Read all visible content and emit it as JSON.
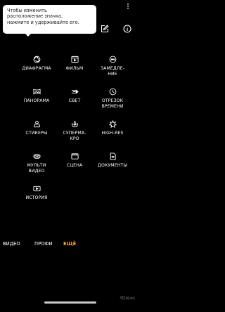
{
  "tooltip": {
    "lines": [
      "Чтобы изменить",
      "расположение значка,",
      "нажмите и удерживайте его."
    ]
  },
  "top_icons": [
    "edit-icon",
    "info-icon"
  ],
  "modes_grid": [
    [
      {
        "icon": "aperture-icon",
        "label": "ДИАФРАГМА"
      },
      {
        "icon": "film-icon",
        "label": "ФИЛЬМ"
      },
      {
        "icon": "slow-motion-icon",
        "label": "ЗАМЕДЛЕ-\nНИЕ"
      }
    ],
    [
      {
        "icon": "panorama-icon",
        "label": "ПАНОРАМА"
      },
      {
        "icon": "light-trails-icon",
        "label": "СВЕТ"
      },
      {
        "icon": "timelapse-icon",
        "label": "ОТРЕЗОК\nВРЕМЕНИ"
      }
    ],
    [
      {
        "icon": "sticker-icon",
        "label": "СТИКЕРЫ"
      },
      {
        "icon": "super-macro-icon",
        "label": "СУПЕРМА-\nКРО"
      },
      {
        "icon": "high-res-icon",
        "label": "HIGH-RES"
      }
    ],
    [
      {
        "icon": "multi-video-icon",
        "label": "МУЛЬТИ\nВИДЕО"
      },
      {
        "icon": "scene-icon",
        "label": "СЦЕНА"
      },
      {
        "icon": "document-icon",
        "label": "ДОКУМЕНТЫ"
      }
    ],
    [
      {
        "icon": "story-icon",
        "label": "ИСТОРИЯ"
      }
    ]
  ],
  "modes_bar": {
    "video": "ВИДЕО",
    "pro": "ПРОФИ",
    "more": "ЕЩЁ"
  },
  "colors": {
    "accent": "#f0a433",
    "background": "#000000",
    "tooltip_bg": "#ffffff"
  },
  "watermark": {
    "line1": "3D",
    "line2": "NEWS"
  }
}
